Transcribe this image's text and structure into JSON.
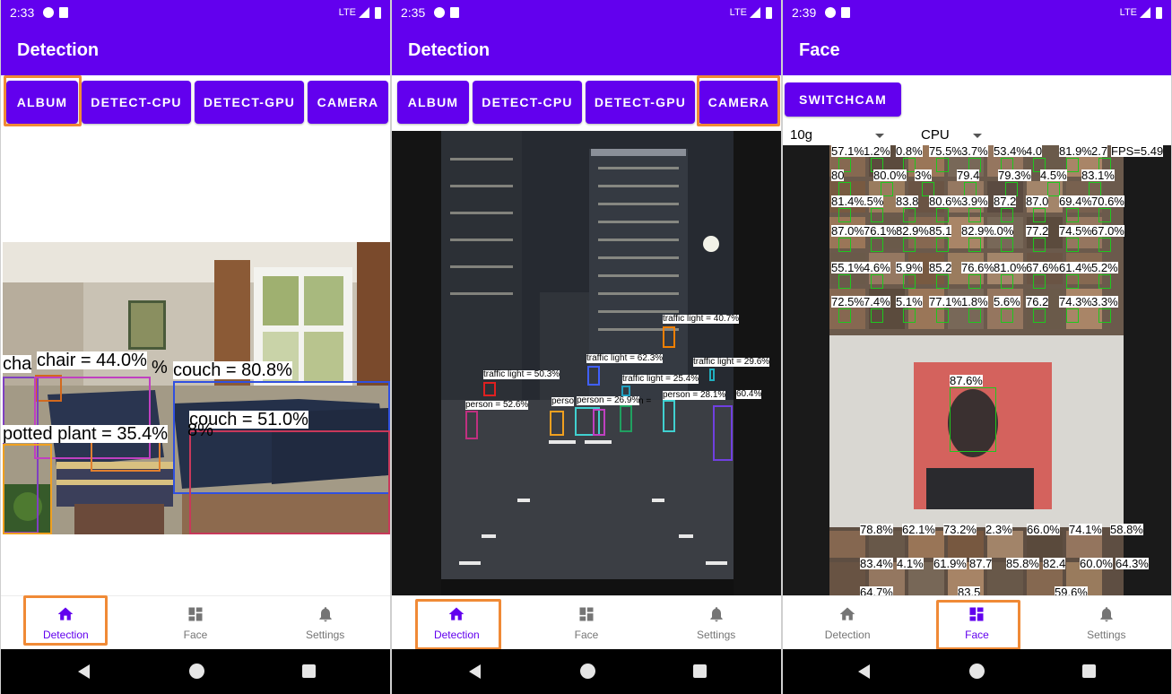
{
  "status": [
    {
      "time": "2:33",
      "network": "LTE"
    },
    {
      "time": "2:35",
      "network": "LTE"
    },
    {
      "time": "2:39",
      "network": "LTE"
    }
  ],
  "screens": [
    {
      "title": "Detection",
      "buttons": [
        "ALBUM",
        "DETECT-CPU",
        "DETECT-GPU",
        "CAMERA"
      ],
      "detections": [
        {
          "label": "chair = 44.0%",
          "color": "#d2691e"
        },
        {
          "label": "couch = 80.8%",
          "color": "#3050e0"
        },
        {
          "label": "couch = 51.0%",
          "color": "#c8385a"
        },
        {
          "label": "potted plant = 35.4%",
          "color": "#f0a020"
        },
        {
          "label": "cha",
          "color": "#8040c0"
        },
        {
          "label": "%",
          "color": "#c040c0"
        },
        {
          "label": "8%",
          "color": "#e08030"
        }
      ]
    },
    {
      "title": "Detection",
      "buttons": [
        "ALBUM",
        "DETECT-CPU",
        "DETECT-GPU",
        "CAMERA"
      ],
      "detections": [
        {
          "label": "traffic light = 40.7%",
          "color": "#f07f00"
        },
        {
          "label": "traffic light = 62.3%",
          "color": "#4060ff"
        },
        {
          "label": "traffic light = 29.6%",
          "color": "#20b0c0"
        },
        {
          "label": "traffic light = 50.3%",
          "color": "#e02020"
        },
        {
          "label": "traffic light = 25.4%",
          "color": "#20a0c0"
        },
        {
          "label": "person = 52.6%",
          "color": "#c03080"
        },
        {
          "label": "person = 26.9%",
          "color": "#f0a020"
        },
        {
          "label": "person = 28.1%",
          "color": "#40d0d0"
        },
        {
          "label": "60.4%",
          "color": "#7040e0"
        },
        {
          "label": "perso",
          "color": "#e08030"
        },
        {
          "label": "n = ",
          "color": "#20a060"
        }
      ]
    },
    {
      "title": "Face",
      "switch_label": "SWITCHCAM",
      "model_select": "10g",
      "device_select": "CPU",
      "fps": "FPS=5.49",
      "top_labels": [
        "57.1%",
        "1.2%",
        "0.8%",
        "75.5%",
        "3.7%",
        "53.4%",
        "4.0",
        "81.9%",
        "2.7",
        "80",
        "80.0%",
        "3%",
        "79.4",
        "79.3%",
        "4.5%",
        "83.1%",
        "81.4%",
        ".5%",
        "83.8",
        "80.6%",
        "3.9%",
        "87.2",
        "87.0",
        "69.4%",
        "70.6%",
        "87.0%",
        "76.1%",
        "82.9%",
        "85.1",
        "82.9%",
        ".0%",
        "77.2",
        "74.5%",
        "67.0%",
        "55.1%",
        "4.6%",
        "5.9%",
        "85.2",
        "76.6%",
        "81.0%",
        "67.6%",
        "61.4%",
        "5.2%",
        "72.5%",
        "7.4%",
        "5.1%",
        "77.1%",
        "1.8%",
        "5.6%",
        "76.2",
        "74.3%",
        "3.3%"
      ],
      "main_face": "87.6%",
      "bottom_labels": [
        "78.8%",
        "62.1%",
        "73.2%",
        "2.3%",
        "66.0%",
        "74.1%",
        "58.8%",
        "83.4%",
        "4.1%",
        "61.9%",
        "87.7",
        "85.8%",
        "82.4",
        "60.0%",
        "64.3%",
        "64.7%",
        "83.5",
        "59.6%"
      ]
    }
  ],
  "nav": {
    "detection": "Detection",
    "face": "Face",
    "settings": "Settings"
  },
  "colors": {
    "primary": "#6200ee",
    "highlight": "#f08a36",
    "face_box": "#1ec81e"
  }
}
